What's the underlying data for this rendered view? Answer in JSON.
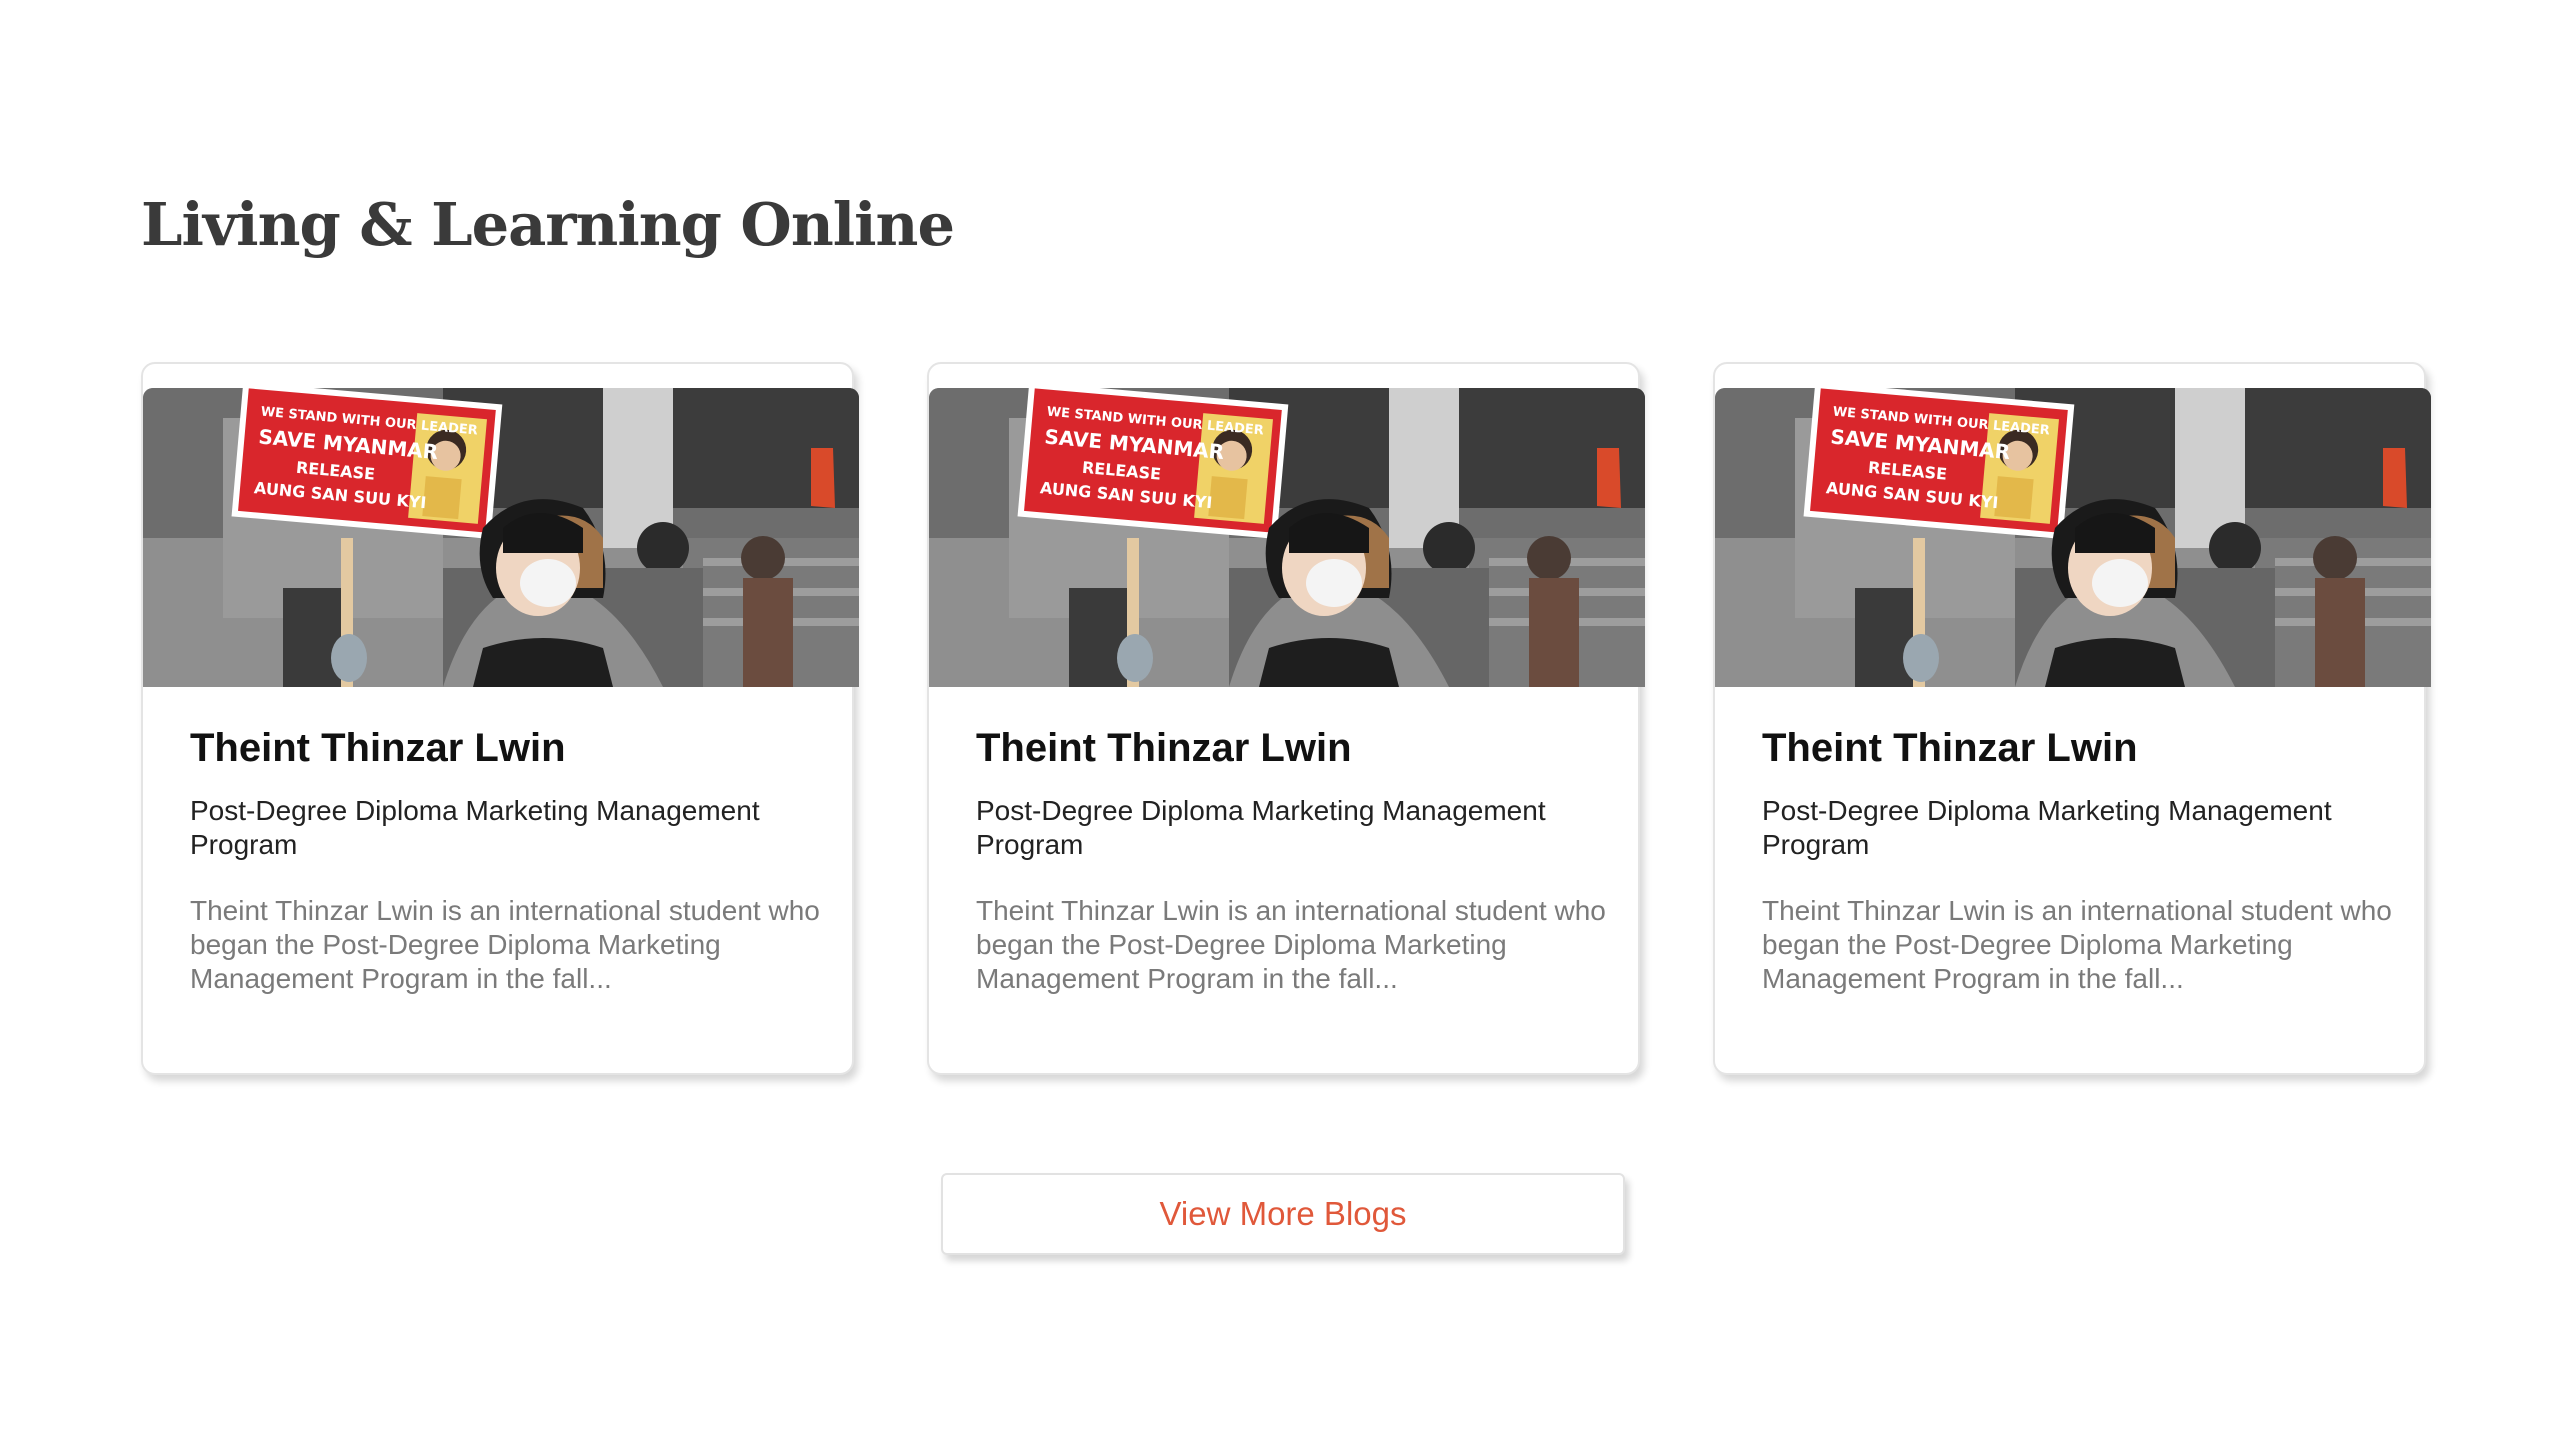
{
  "section": {
    "title": "Living & Learning Online"
  },
  "cards": [
    {
      "name": "Theint Thinzar Lwin",
      "program": "Post-Degree Diploma Marketing Management Program",
      "excerpt": "Theint Thinzar Lwin is an international student who began the Post-Degree Diploma Marketing Management Program in the fall...",
      "sign": {
        "line1": "WE STAND WITH OUR LEADER",
        "line2": "SAVE MYANMAR",
        "line3": "RELEASE",
        "line4": "AUNG SAN SUU KYI"
      }
    },
    {
      "name": "Theint Thinzar Lwin",
      "program": "Post-Degree Diploma Marketing Management Program",
      "excerpt": "Theint Thinzar Lwin is an international student who began the Post-Degree Diploma Marketing Management Program in the fall...",
      "sign": {
        "line1": "WE STAND WITH OUR LEADER",
        "line2": "SAVE MYANMAR",
        "line3": "RELEASE",
        "line4": "AUNG SAN SUU KYI"
      }
    },
    {
      "name": "Theint Thinzar Lwin",
      "program": "Post-Degree Diploma Marketing Management Program",
      "excerpt": "Theint Thinzar Lwin is an international student who began the Post-Degree Diploma Marketing Management Program in the fall...",
      "sign": {
        "line1": "WE STAND WITH OUR LEADER",
        "line2": "SAVE MYANMAR",
        "line3": "RELEASE",
        "line4": "AUNG SAN SUU KYI"
      }
    }
  ],
  "more_button": {
    "label": "View More Blogs"
  },
  "colors": {
    "accent": "#e0583a",
    "title": "#3a3a3a",
    "sign_red": "#d9262c"
  }
}
